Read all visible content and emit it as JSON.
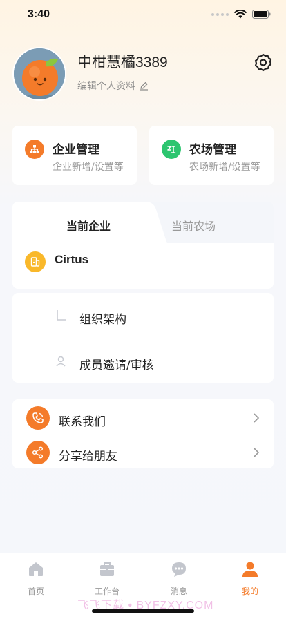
{
  "status_bar": {
    "time": "3:40"
  },
  "profile": {
    "username": "中柑慧橘3389",
    "edit_label": "编辑个人资料"
  },
  "management": {
    "enterprise": {
      "title": "企业管理",
      "subtitle": "企业新增/设置等"
    },
    "farm": {
      "title": "农场管理",
      "subtitle": "农场新增/设置等"
    }
  },
  "tabs": {
    "current_enterprise": "当前企业",
    "current_farm": "当前农场",
    "selected": "当前企业"
  },
  "company": {
    "name": "Cirtus"
  },
  "org_menu": {
    "structure": "组织架构",
    "invite": "成员邀请/审核"
  },
  "links": {
    "contact": "联系我们",
    "share": "分享给朋友"
  },
  "tabbar": {
    "home": "首页",
    "workbench": "工作台",
    "messages": "消息",
    "mine": "我的",
    "active": "我的"
  },
  "watermark": "飞飞下载 • BYFZXY.COM",
  "colors": {
    "accent": "#f47b2a",
    "farm_green": "#2cc56f",
    "company_yellow": "#f9b82a"
  }
}
